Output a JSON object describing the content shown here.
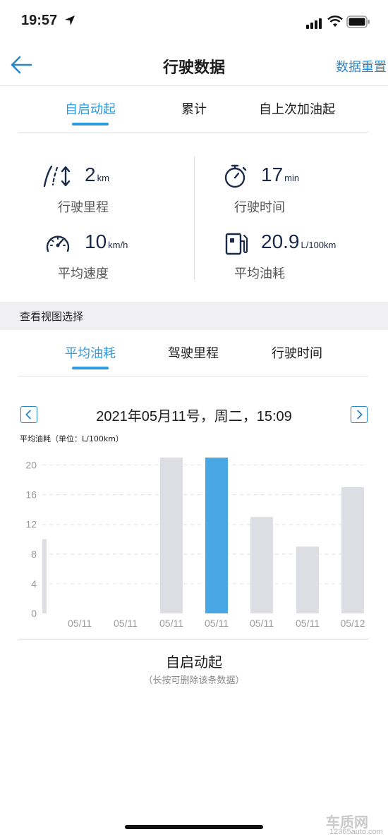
{
  "status_bar": {
    "time": "19:57"
  },
  "header": {
    "title": "行驶数据",
    "reset_label": "数据重置"
  },
  "range_tabs": [
    {
      "label": "自启动起",
      "active": true
    },
    {
      "label": "累计",
      "active": false
    },
    {
      "label": "自上次加油起",
      "active": false
    }
  ],
  "stats": {
    "distance": {
      "value": "2",
      "unit": "km",
      "label": "行驶里程",
      "icon": "road-icon"
    },
    "time": {
      "value": "17",
      "unit": "min",
      "label": "行驶时间",
      "icon": "stopwatch-icon"
    },
    "speed": {
      "value": "10",
      "unit": "km/h",
      "label": "平均速度",
      "icon": "speedometer-icon"
    },
    "fuel": {
      "value": "20.9",
      "unit": "L/100km",
      "label": "平均油耗",
      "icon": "fuel-pump-icon"
    }
  },
  "view_section": {
    "label": "查看视图选择"
  },
  "view_tabs": [
    {
      "label": "平均油耗",
      "active": true
    },
    {
      "label": "驾驶里程",
      "active": false
    },
    {
      "label": "行驶时间",
      "active": false
    }
  ],
  "date_nav": {
    "text": "2021年05月11号，周二，15:09"
  },
  "chart_unit_label": "平均油耗（单位：L/100km）",
  "chart_data": {
    "type": "bar",
    "categories": [
      "",
      "05/11",
      "05/11",
      "05/11",
      "05/11",
      "05/11",
      "05/11",
      "05/12"
    ],
    "values": [
      10,
      0,
      0,
      21,
      21,
      13,
      9,
      17
    ],
    "selected_index": 4,
    "yticks": [
      0,
      4,
      8,
      12,
      16,
      20
    ],
    "ylim": [
      0,
      21
    ],
    "grid": true,
    "colors": {
      "bar": "#dcdee3",
      "selected": "#4aa7e6",
      "grid": "#e2e2e2",
      "tick": "#9a9a9a"
    }
  },
  "footer": {
    "title": "自启动起",
    "subtitle": "（长按可删除该条数据）"
  },
  "watermark": {
    "brand": "车质网",
    "url": "12365auto.com"
  },
  "colors": {
    "accent": "#2f9be0",
    "link": "#2b86c9",
    "value_text": "#1b2a48"
  }
}
